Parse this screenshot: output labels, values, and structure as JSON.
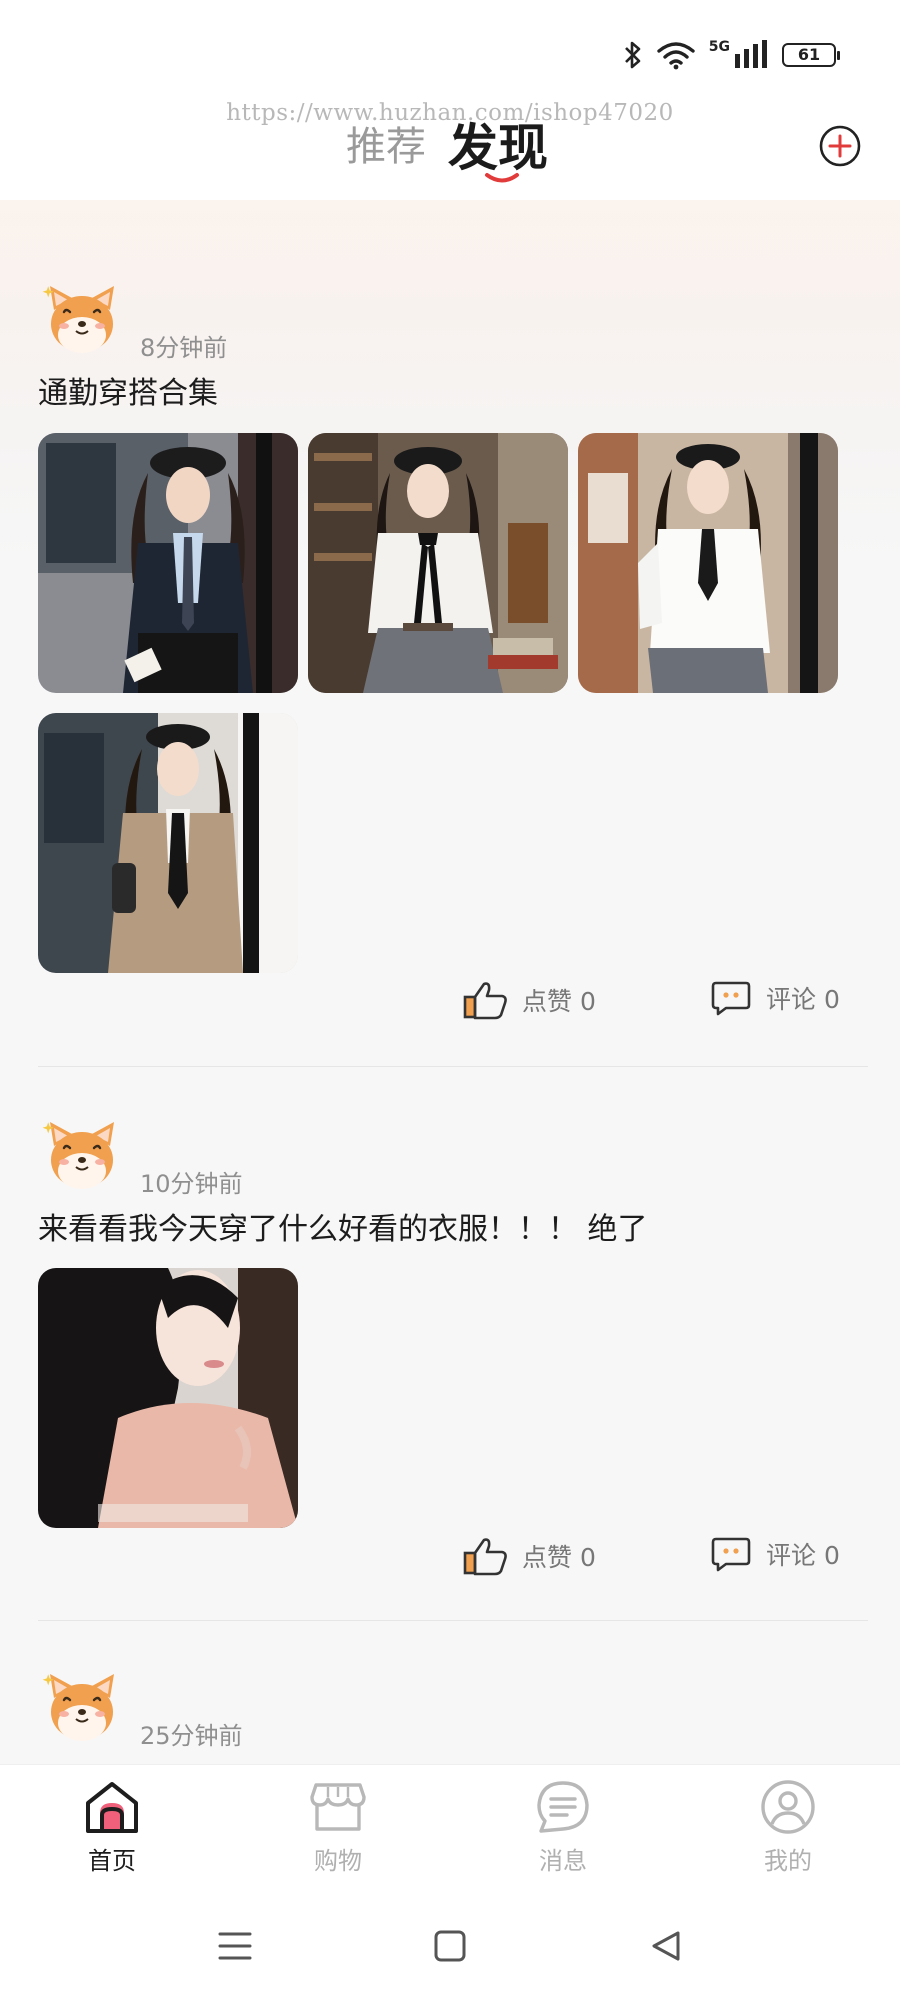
{
  "status_bar": {
    "network": "5G",
    "battery": "61"
  },
  "header": {
    "watermark": "https://www.huzhan.com/ishop47020",
    "tabs": [
      {
        "label": "推荐",
        "active": false
      },
      {
        "label": "发现",
        "active": true
      }
    ],
    "add_icon": "plus-circle-icon",
    "accent_color": "#e23b3b"
  },
  "feed": {
    "posts": [
      {
        "avatar": "shiba-dog-avatar",
        "time": "8分钟前",
        "text": "通勤穿搭合集",
        "photos": [
          "woman-navy-trench-coat",
          "woman-white-blouse-bow",
          "woman-white-shirt-tie",
          "woman-beige-blazer"
        ],
        "like_label": "点赞 0",
        "comment_label": "评论 0"
      },
      {
        "avatar": "shiba-dog-avatar",
        "time": "10分钟前",
        "text": "来看看我今天穿了什么好看的衣服！！！ 绝了",
        "photos": [
          "woman-long-black-hair"
        ],
        "like_label": "点赞 0",
        "comment_label": "评论 0"
      },
      {
        "avatar": "shiba-dog-avatar",
        "time": "25分钟前",
        "text": ""
      }
    ]
  },
  "bottom_nav": {
    "items": [
      {
        "label": "首页",
        "icon": "home-icon",
        "active": true
      },
      {
        "label": "购物",
        "icon": "shop-icon",
        "active": false
      },
      {
        "label": "消息",
        "icon": "message-icon",
        "active": false
      },
      {
        "label": "我的",
        "icon": "profile-icon",
        "active": false
      }
    ]
  },
  "system_nav": {
    "buttons": [
      "menu-icon",
      "home-square-icon",
      "back-triangle-icon"
    ]
  }
}
